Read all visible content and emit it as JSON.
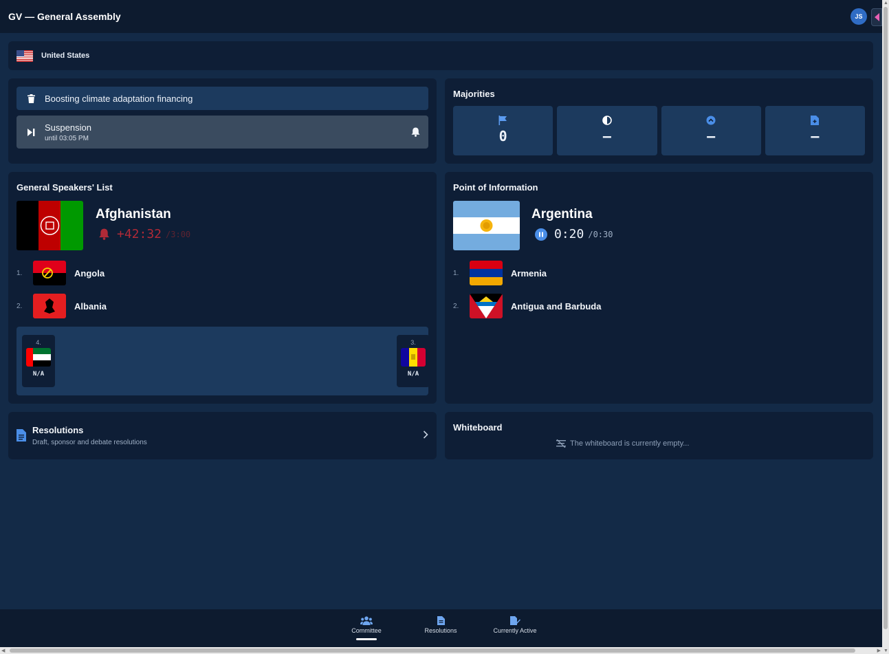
{
  "header": {
    "title": "GV — General Assembly",
    "avatar_initials": "JS"
  },
  "delegation": {
    "name": "United States"
  },
  "agenda": {
    "topic": "Boosting climate adaptation financing",
    "status": "Suspension",
    "status_detail": "until 03:05 PM"
  },
  "majorities": {
    "title": "Majorities",
    "items": [
      {
        "icon": "flag-icon",
        "value": "0"
      },
      {
        "icon": "half-circle-icon",
        "value": "–"
      },
      {
        "icon": "chevron-up-circle-icon",
        "value": "–"
      },
      {
        "icon": "document-plus-icon",
        "value": "–"
      }
    ]
  },
  "speakers_list": {
    "title": "General Speakers' List",
    "current": {
      "country": "Afghanistan",
      "time": "+42:32",
      "total": "/3:00"
    },
    "queue": [
      {
        "num": "1.",
        "country": "Angola"
      },
      {
        "num": "2.",
        "country": "Albania"
      }
    ],
    "bench": [
      {
        "num": "4.",
        "value": "N/A"
      },
      {
        "num": "3.",
        "value": "N/A"
      }
    ]
  },
  "poi": {
    "title": "Point of Information",
    "current": {
      "country": "Argentina",
      "time": "0:20",
      "total": "/0:30"
    },
    "queue": [
      {
        "num": "1.",
        "country": "Armenia"
      },
      {
        "num": "2.",
        "country": "Antigua and Barbuda"
      }
    ]
  },
  "resolutions": {
    "title": "Resolutions",
    "subtitle": "Draft, sponsor and debate resolutions"
  },
  "whiteboard": {
    "title": "Whiteboard",
    "empty_text": "The whiteboard is currently empty..."
  },
  "bottom_nav": [
    {
      "label": "Committee",
      "active": true
    },
    {
      "label": "Resolutions",
      "active": false
    },
    {
      "label": "Currently Active",
      "active": false
    }
  ],
  "colors": {
    "background": "#132a47",
    "panel": "#0e1e36",
    "accent": "#2f6cc4",
    "alert_red": "#b02a37"
  }
}
